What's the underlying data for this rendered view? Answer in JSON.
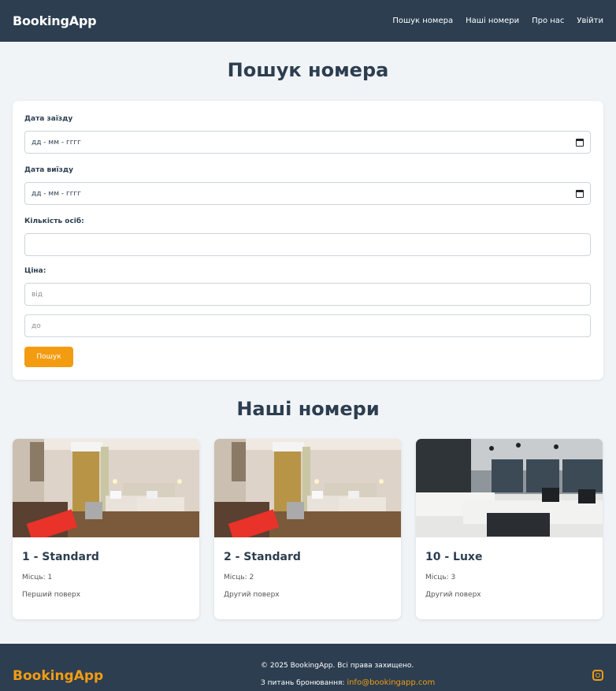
{
  "nav": {
    "brand": "BookingApp",
    "links": [
      "Пошук номера",
      "Наші номери",
      "Про нас",
      "Увійти"
    ]
  },
  "search": {
    "title": "Пошук номера",
    "checkin_label": "Дата заїзду",
    "checkin_value": "дд - мм - гггг",
    "checkout_label": "Дата виїзду",
    "checkout_value": "дд - мм - гггг",
    "guests_label": "Кількість осіб:",
    "price_label": "Ціна:",
    "price_from_placeholder": "від",
    "price_to_placeholder": "до",
    "button_label": "Пошук",
    "icons": [
      "calendar-icon"
    ]
  },
  "rooms": {
    "title": "Наші номери",
    "items": [
      {
        "name": "1 - Standard",
        "places": "Місць: 1",
        "floor": "Перший поверх",
        "image": "standard-room"
      },
      {
        "name": "2 - Standard",
        "places": "Місць: 2",
        "floor": "Другий поверх",
        "image": "standard-room"
      },
      {
        "name": "10 - Luxe",
        "places": "Місць: 3",
        "floor": "Другий поверх",
        "image": "luxe-room"
      }
    ]
  },
  "footer": {
    "brand": "BookingApp",
    "copyright": "© 2025 BookingApp. Всі права захищено.",
    "contact_text": "З питань бронювання:",
    "contact_email": "info@bookingapp.com",
    "icons": [
      "instagram-icon"
    ]
  },
  "colors": {
    "navbar": "#2c3e50",
    "accent": "#f39c12",
    "background": "#f1f4f7"
  }
}
